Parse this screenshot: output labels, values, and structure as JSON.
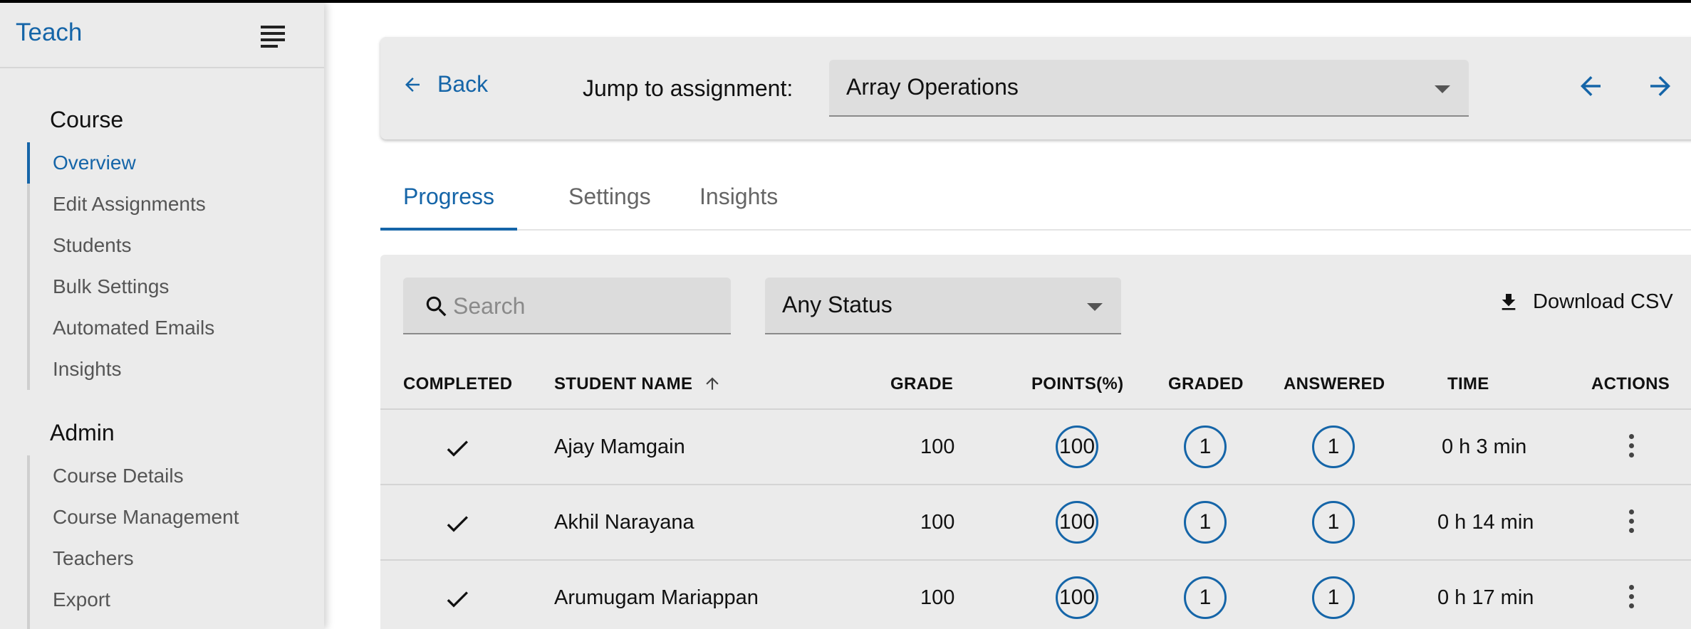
{
  "app": {
    "title": "Teach"
  },
  "sidebar": {
    "course_title": "Course",
    "course_items": [
      {
        "label": "Overview"
      },
      {
        "label": "Edit Assignments"
      },
      {
        "label": "Students"
      },
      {
        "label": "Bulk Settings"
      },
      {
        "label": "Automated Emails"
      },
      {
        "label": "Insights"
      }
    ],
    "admin_title": "Admin",
    "admin_items": [
      {
        "label": "Course Details"
      },
      {
        "label": "Course Management"
      },
      {
        "label": "Teachers"
      },
      {
        "label": "Export"
      }
    ]
  },
  "topbar": {
    "back_label": "Back",
    "jump_label": "Jump to assignment:",
    "assignment": "Array Operations"
  },
  "tabs": [
    {
      "label": "Progress"
    },
    {
      "label": "Settings"
    },
    {
      "label": "Insights"
    }
  ],
  "toolbar": {
    "search_placeholder": "Search",
    "status": "Any Status",
    "download_label": "Download CSV"
  },
  "table": {
    "headers": {
      "completed": "COMPLETED",
      "student_name": "STUDENT NAME",
      "grade": "GRADE",
      "points": "POINTS(%)",
      "graded": "GRADED",
      "answered": "ANSWERED",
      "time": "TIME",
      "actions": "ACTIONS"
    },
    "rows": [
      {
        "name": "Ajay Mamgain",
        "grade": "100",
        "points": "100",
        "graded": "1",
        "answered": "1",
        "time": "0 h 3 min"
      },
      {
        "name": "Akhil Narayana",
        "grade": "100",
        "points": "100",
        "graded": "1",
        "answered": "1",
        "time": "0 h 14 min"
      },
      {
        "name": "Arumugam Mariappan",
        "grade": "100",
        "points": "100",
        "graded": "1",
        "answered": "1",
        "time": "0 h 17 min"
      }
    ]
  },
  "colors": {
    "accent": "#1565a8",
    "panel": "#ebebeb",
    "field": "#dcdcdc"
  }
}
